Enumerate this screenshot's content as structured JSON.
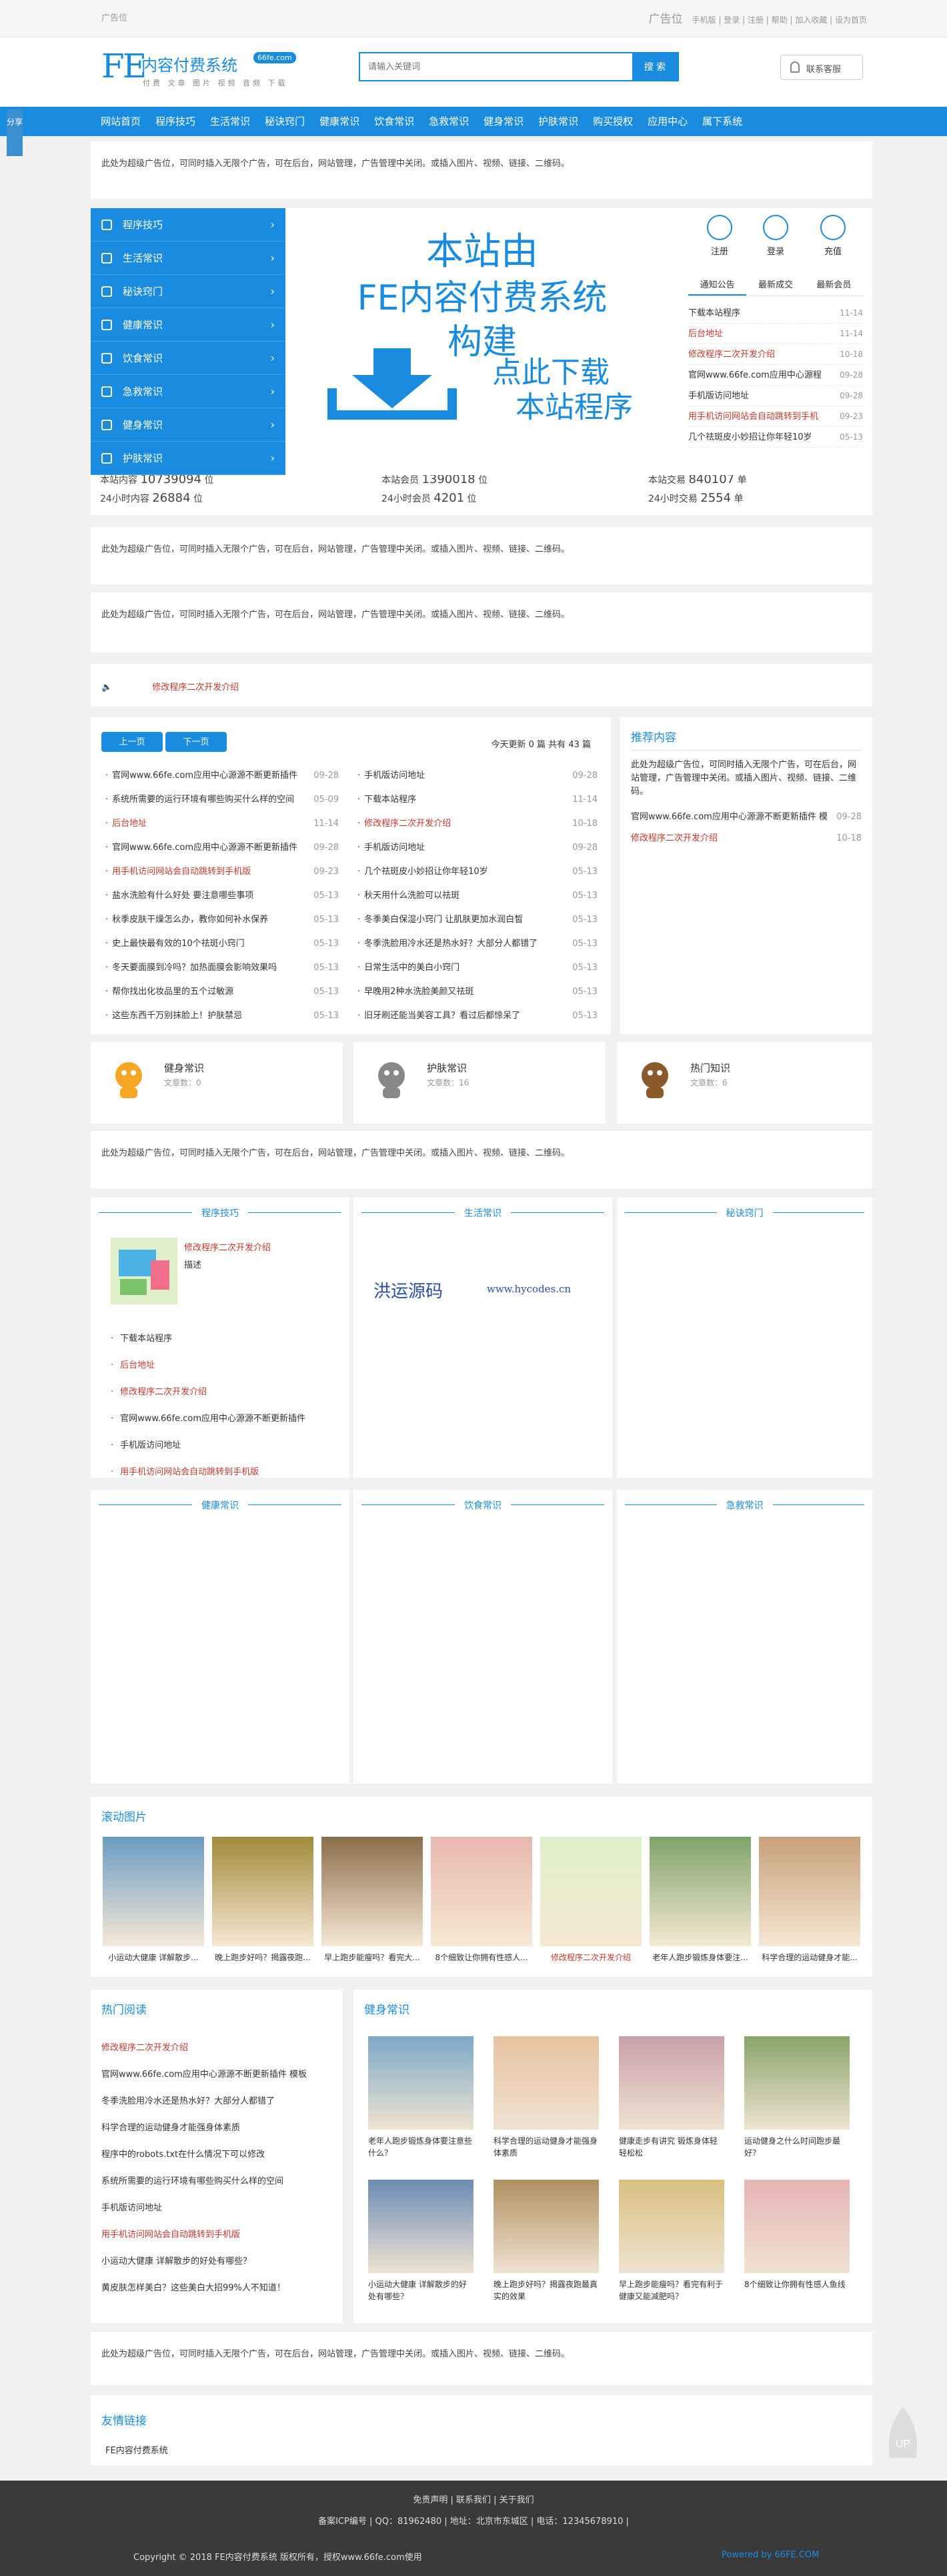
{
  "top": {
    "ad": "广告位",
    "right_ad": "广告位",
    "links": "手机版 | 登录 | 注册 | 帮助 | 加入收藏 | 设为首页"
  },
  "logo": {
    "mark": "FE",
    "name": "内容付费系统",
    "domain": "66fe.com",
    "sub": "付费 文章 图片 视频 音频 下载"
  },
  "search": {
    "placeholder": "请输入关键词",
    "button": "搜 索"
  },
  "contact": "联系客服",
  "nav": [
    "网站首页",
    "程序技巧",
    "生活常识",
    "秘诀窍门",
    "健康常识",
    "饮食常识",
    "急救常识",
    "健身常识",
    "护肤常识",
    "购买授权",
    "应用中心",
    "属下系统"
  ],
  "share": "分享",
  "ad_text": "此处为超级广告位，可同时插入无限个广告，可在后台，网站管理，广告管理中关闭。或插入图片、视频、链接、二维码。",
  "menu": [
    "程序技巧",
    "生活常识",
    "秘诀窍门",
    "健康常识",
    "饮食常识",
    "急救常识",
    "健身常识",
    "护肤常识"
  ],
  "banner": {
    "l1": "本站由",
    "l2": "FE内容付费系统",
    "l3": "构建",
    "t1": "点此下载",
    "t2": "本站程序"
  },
  "user": {
    "register": "注册",
    "login": "登录",
    "recharge": "充值"
  },
  "tabs": [
    "通知公告",
    "最新成交",
    "最新会员"
  ],
  "notices": [
    {
      "t": "下载本站程序",
      "d": "11-14",
      "red": false
    },
    {
      "t": "后台地址",
      "d": "11-14",
      "red": true
    },
    {
      "t": "修改程序二次开发介绍",
      "d": "10-18",
      "red": true
    },
    {
      "t": "官网www.66fe.com应用中心源程",
      "d": "09-28",
      "red": false
    },
    {
      "t": "手机版访问地址",
      "d": "09-28",
      "red": false
    },
    {
      "t": "用手机访问网站会自动跳转到手机",
      "d": "09-23",
      "red": true
    },
    {
      "t": "几个祛斑皮小妙招让你年轻10岁",
      "d": "05-13",
      "red": false
    }
  ],
  "stats": [
    {
      "label": "本站内容",
      "value": "10739094",
      "unit": "位"
    },
    {
      "label": "24小时内容",
      "value": "26884",
      "unit": "位"
    },
    {
      "label": "本站会员",
      "value": "1390018",
      "unit": "位"
    },
    {
      "label": "24小时会员",
      "value": "4201",
      "unit": "位"
    },
    {
      "label": "本站交易",
      "value": "840107",
      "unit": "单"
    },
    {
      "label": "24小时交易",
      "value": "2554",
      "unit": "单"
    }
  ],
  "notice_bar": {
    "title": "修改程序二次开发介绍"
  },
  "pager": {
    "prev": "上一页",
    "next": "下一页",
    "update_text": "今天更新 0 篇 共有 43 篇"
  },
  "list_left": [
    {
      "t": "官网www.66fe.com应用中心源源不断更新插件",
      "d": "09-28",
      "red": false
    },
    {
      "t": "系统所需要的运行环境有哪些购买什么样的空间",
      "d": "05-09",
      "red": false
    },
    {
      "t": "后台地址",
      "d": "11-14",
      "red": true
    },
    {
      "t": "官网www.66fe.com应用中心源源不断更新插件",
      "d": "09-28",
      "red": false
    },
    {
      "t": "用手机访问网站会自动跳转到手机版",
      "d": "09-23",
      "red": true
    },
    {
      "t": "盐水洗脸有什么好处 要注意哪些事项",
      "d": "05-13",
      "red": false
    },
    {
      "t": "秋季皮肤干燥怎么办，教你如何补水保养",
      "d": "05-13",
      "red": false
    },
    {
      "t": "史上最快最有效的10个祛斑小窍门",
      "d": "05-13",
      "red": false
    },
    {
      "t": "冬天要面膜到冷吗？加热面膜会影响效果吗",
      "d": "05-13",
      "red": false
    },
    {
      "t": "帮你找出化妆品里的五个过敏源",
      "d": "05-13",
      "red": false
    },
    {
      "t": "这些东西千万别抹脸上！护肤禁忌",
      "d": "05-13",
      "red": false
    }
  ],
  "list_right": [
    {
      "t": "手机版访问地址",
      "d": "09-28",
      "red": false
    },
    {
      "t": "下载本站程序",
      "d": "11-14",
      "red": false
    },
    {
      "t": "修改程序二次开发介绍",
      "d": "10-18",
      "red": true
    },
    {
      "t": "手机版访问地址",
      "d": "09-28",
      "red": false
    },
    {
      "t": "几个祛斑皮小妙招让你年轻10岁",
      "d": "05-13",
      "red": false
    },
    {
      "t": "秋天用什么洗脸可以祛斑",
      "d": "05-13",
      "red": false
    },
    {
      "t": "冬季美白保湿小窍门 让肌肤更加水润白皙",
      "d": "05-13",
      "red": false
    },
    {
      "t": "冬季洗脸用冷水还是热水好？大部分人都错了",
      "d": "05-13",
      "red": false
    },
    {
      "t": "日常生活中的美白小窍门",
      "d": "05-13",
      "red": false
    },
    {
      "t": "早晚用2种水洗脸美颜又祛斑",
      "d": "05-13",
      "red": false
    },
    {
      "t": "旧牙刷还能当美容工具？看过后都惊呆了",
      "d": "05-13",
      "red": false
    }
  ],
  "rec": {
    "title": "推荐内容",
    "items": [
      {
        "t": "官网www.66fe.com应用中心源源不断更新插件 模",
        "d": "09-28",
        "red": false
      },
      {
        "t": "修改程序二次开发介绍",
        "d": "10-18",
        "red": true
      }
    ]
  },
  "cats": [
    {
      "t": "健身常识",
      "n": "文章数：0"
    },
    {
      "t": "护肤常识",
      "n": "文章数：16"
    },
    {
      "t": "热门知识",
      "n": "文章数：6"
    }
  ],
  "cols1": [
    "程序技巧",
    "生活常识",
    "秘诀窍门"
  ],
  "col_feature": {
    "title": "修改程序二次开发介绍",
    "desc": "描述"
  },
  "col_list": [
    "下载本站程序",
    "后台地址",
    "修改程序二次开发介绍",
    "官网www.66fe.com应用中心源源不断更新插件",
    "手机版访问地址",
    "用手机访问网站会自动跳转到手机版"
  ],
  "col_list_red": [
    false,
    true,
    true,
    false,
    false,
    true
  ],
  "watermark": {
    "a": "洪运源码",
    "b": "www.hycodes.cn"
  },
  "cols2": [
    "健康常识",
    "饮食常识",
    "急救常识"
  ],
  "gallery": {
    "title": "滚动图片",
    "caps": [
      "小运动大健康 详解散步...",
      "晚上跑步好吗？揭露夜跑...",
      "早上跑步能瘦吗？看完大...",
      "8个细致让你拥有性感人...",
      "修改程序二次开发介绍",
      "老年人跑步锻炼身体要注...",
      "科学合理的运动健身才能..."
    ]
  },
  "hot": {
    "title": "热门阅读",
    "items": [
      "修改程序二次开发介绍",
      "官网www.66fe.com应用中心源源不断更新插件 模板",
      "冬季洗脸用冷水还是热水好？大部分人都错了",
      "科学合理的运动健身才能强身体素质",
      "程序中的robots.txt在什么情况下可以修改",
      "系统所需要的运行环境有哪些购买什么样的空间",
      "手机版访问地址",
      "用手机访问网站会自动跳转到手机版",
      "小运动大健康 详解散步的好处有哪些？",
      "黄皮肤怎样美白？这些美白大招99%人不知道！"
    ],
    "red": [
      true,
      false,
      false,
      false,
      false,
      false,
      false,
      true,
      false,
      false
    ]
  },
  "fitness": {
    "title": "健身常识",
    "caps": [
      "老年人跑步锻炼身体要注意些什么？",
      "科学合理的运动健身才能强身体素质",
      "健康走步有讲究 锻炼身体轻轻松松",
      "运动健身之什么时间跑步最好？",
      "小运动大健康 详解散步的好处有哪些？",
      "晚上跑步好吗？揭露夜跑最真实的效果",
      "早上跑步能瘦吗？看完有利于健康又能减肥吗？",
      "8个细致让你拥有性感人鱼线"
    ]
  },
  "links": {
    "title": "友情链接",
    "item": "FE内容付费系统"
  },
  "footer": {
    "f1": "免责声明 | 联系我们 | 关于我们",
    "f2": "备案ICP编号 | QQ：81962480 | 地址：北京市东城区 | 电话：12345678910 |",
    "f3": "Copyright © 2018 FE内容付费系统 版权所有，授权www.66fe.com使用",
    "f4": "Powered by 66FE.COM"
  },
  "up": "UP",
  "colors": {
    "accent": "#1a8ce0",
    "red": "#c0392b"
  }
}
